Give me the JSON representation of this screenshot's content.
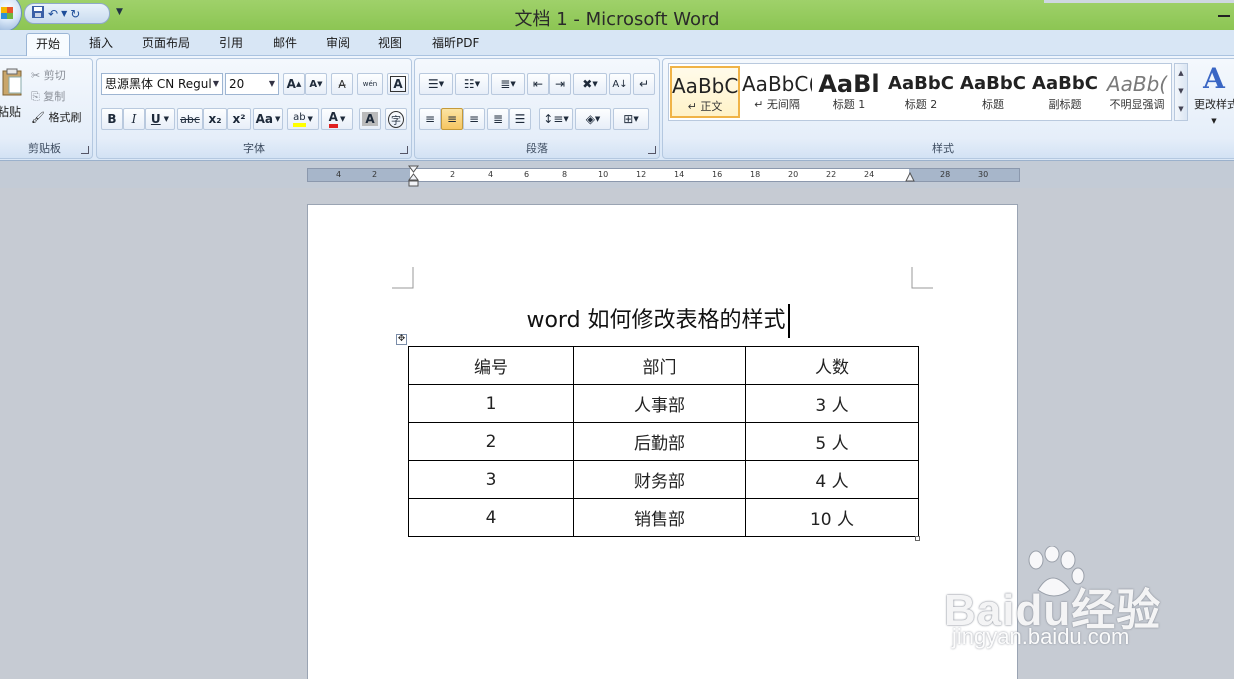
{
  "window": {
    "title": "文档 1 - Microsoft Word"
  },
  "quick_access": {
    "save_icon": "save-icon",
    "undo_icon": "undo-icon",
    "redo_icon": "redo-icon"
  },
  "tabs": [
    {
      "label": "开始",
      "active": true
    },
    {
      "label": "插入"
    },
    {
      "label": "页面布局"
    },
    {
      "label": "引用"
    },
    {
      "label": "邮件"
    },
    {
      "label": "审阅"
    },
    {
      "label": "视图"
    },
    {
      "label": "福昕PDF"
    }
  ],
  "clipboard": {
    "group_label": "剪贴板",
    "paste": "粘贴",
    "cut": "剪切",
    "copy": "复制",
    "format_painter": "格式刷"
  },
  "font": {
    "group_label": "字体",
    "family": "思源黑体 CN Regul",
    "size": "20",
    "grow": "A",
    "shrink": "A",
    "phonetic": "wén",
    "bold": "B",
    "italic": "I",
    "underline": "U",
    "strike": "abc",
    "subscript": "x₂",
    "superscript": "x²",
    "change_case": "Aa",
    "highlight": "ab",
    "font_color": "A",
    "shading": "A",
    "enclose": "字"
  },
  "paragraph": {
    "group_label": "段落"
  },
  "styles": {
    "group_label": "样式",
    "items": [
      {
        "preview": "AaBbC(",
        "name": "↵ 正文"
      },
      {
        "preview": "AaBbC(",
        "name": "↵ 无间隔"
      },
      {
        "preview": "AaBl",
        "name": "标题 1"
      },
      {
        "preview": "AaBbC",
        "name": "标题 2"
      },
      {
        "preview": "AaBbC",
        "name": "标题"
      },
      {
        "preview": "AaBbC",
        "name": "副标题"
      },
      {
        "preview": "AaBb(",
        "name": "不明显强调"
      }
    ],
    "change_styles": "更改样式"
  },
  "ruler": {
    "labels": [
      "4",
      "2",
      "2",
      "4",
      "6",
      "8",
      "10",
      "12",
      "14",
      "16",
      "18",
      "20",
      "22",
      "24",
      "28",
      "30"
    ]
  },
  "document": {
    "title": "word 如何修改表格的样式",
    "table": [
      [
        "编号",
        "部门",
        "人数"
      ],
      [
        "1",
        "人事部",
        "3 人"
      ],
      [
        "2",
        "后勤部",
        "5 人"
      ],
      [
        "3",
        "财务部",
        "4 人"
      ],
      [
        "4",
        "销售部",
        "10 人"
      ]
    ]
  },
  "watermark": {
    "brand": "Baidu经验",
    "url": "jingyan.baidu.com"
  }
}
